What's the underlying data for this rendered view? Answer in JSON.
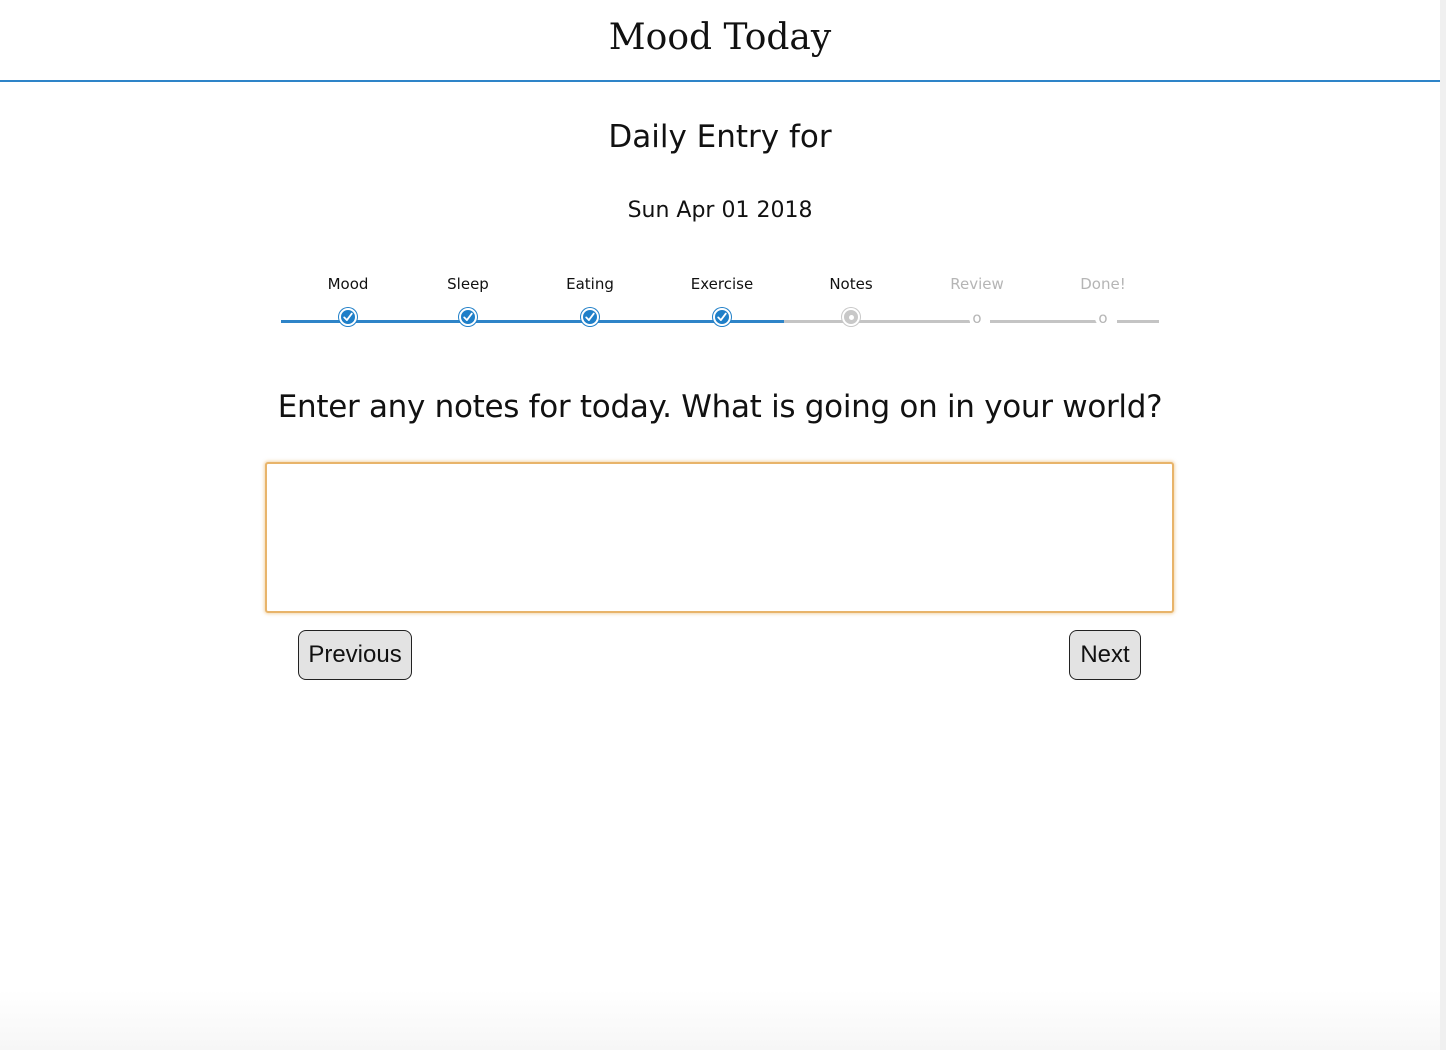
{
  "header": {
    "title": "Mood Today"
  },
  "entry": {
    "heading": "Daily Entry for",
    "date": "Sun Apr 01 2018"
  },
  "stepper": {
    "steps": [
      {
        "label": "Mood",
        "status": "complete"
      },
      {
        "label": "Sleep",
        "status": "complete"
      },
      {
        "label": "Eating",
        "status": "complete"
      },
      {
        "label": "Exercise",
        "status": "complete"
      },
      {
        "label": "Notes",
        "status": "current"
      },
      {
        "label": "Review",
        "status": "pending",
        "marker": "o"
      },
      {
        "label": "Done!",
        "status": "pending",
        "marker": "o"
      }
    ]
  },
  "notes": {
    "question": "Enter any notes for today. What is going on in your world?",
    "value": "",
    "placeholder": ""
  },
  "buttons": {
    "previous": "Previous",
    "next": "Next"
  },
  "colors": {
    "accent": "#2e84c8",
    "completed_step": "#1f7fc8",
    "inactive": "#c4c4c4",
    "input_focus": "#e8b46a"
  },
  "icons": {
    "complete_step": "check-circle-icon",
    "current_step": "dot-circle-icon"
  }
}
